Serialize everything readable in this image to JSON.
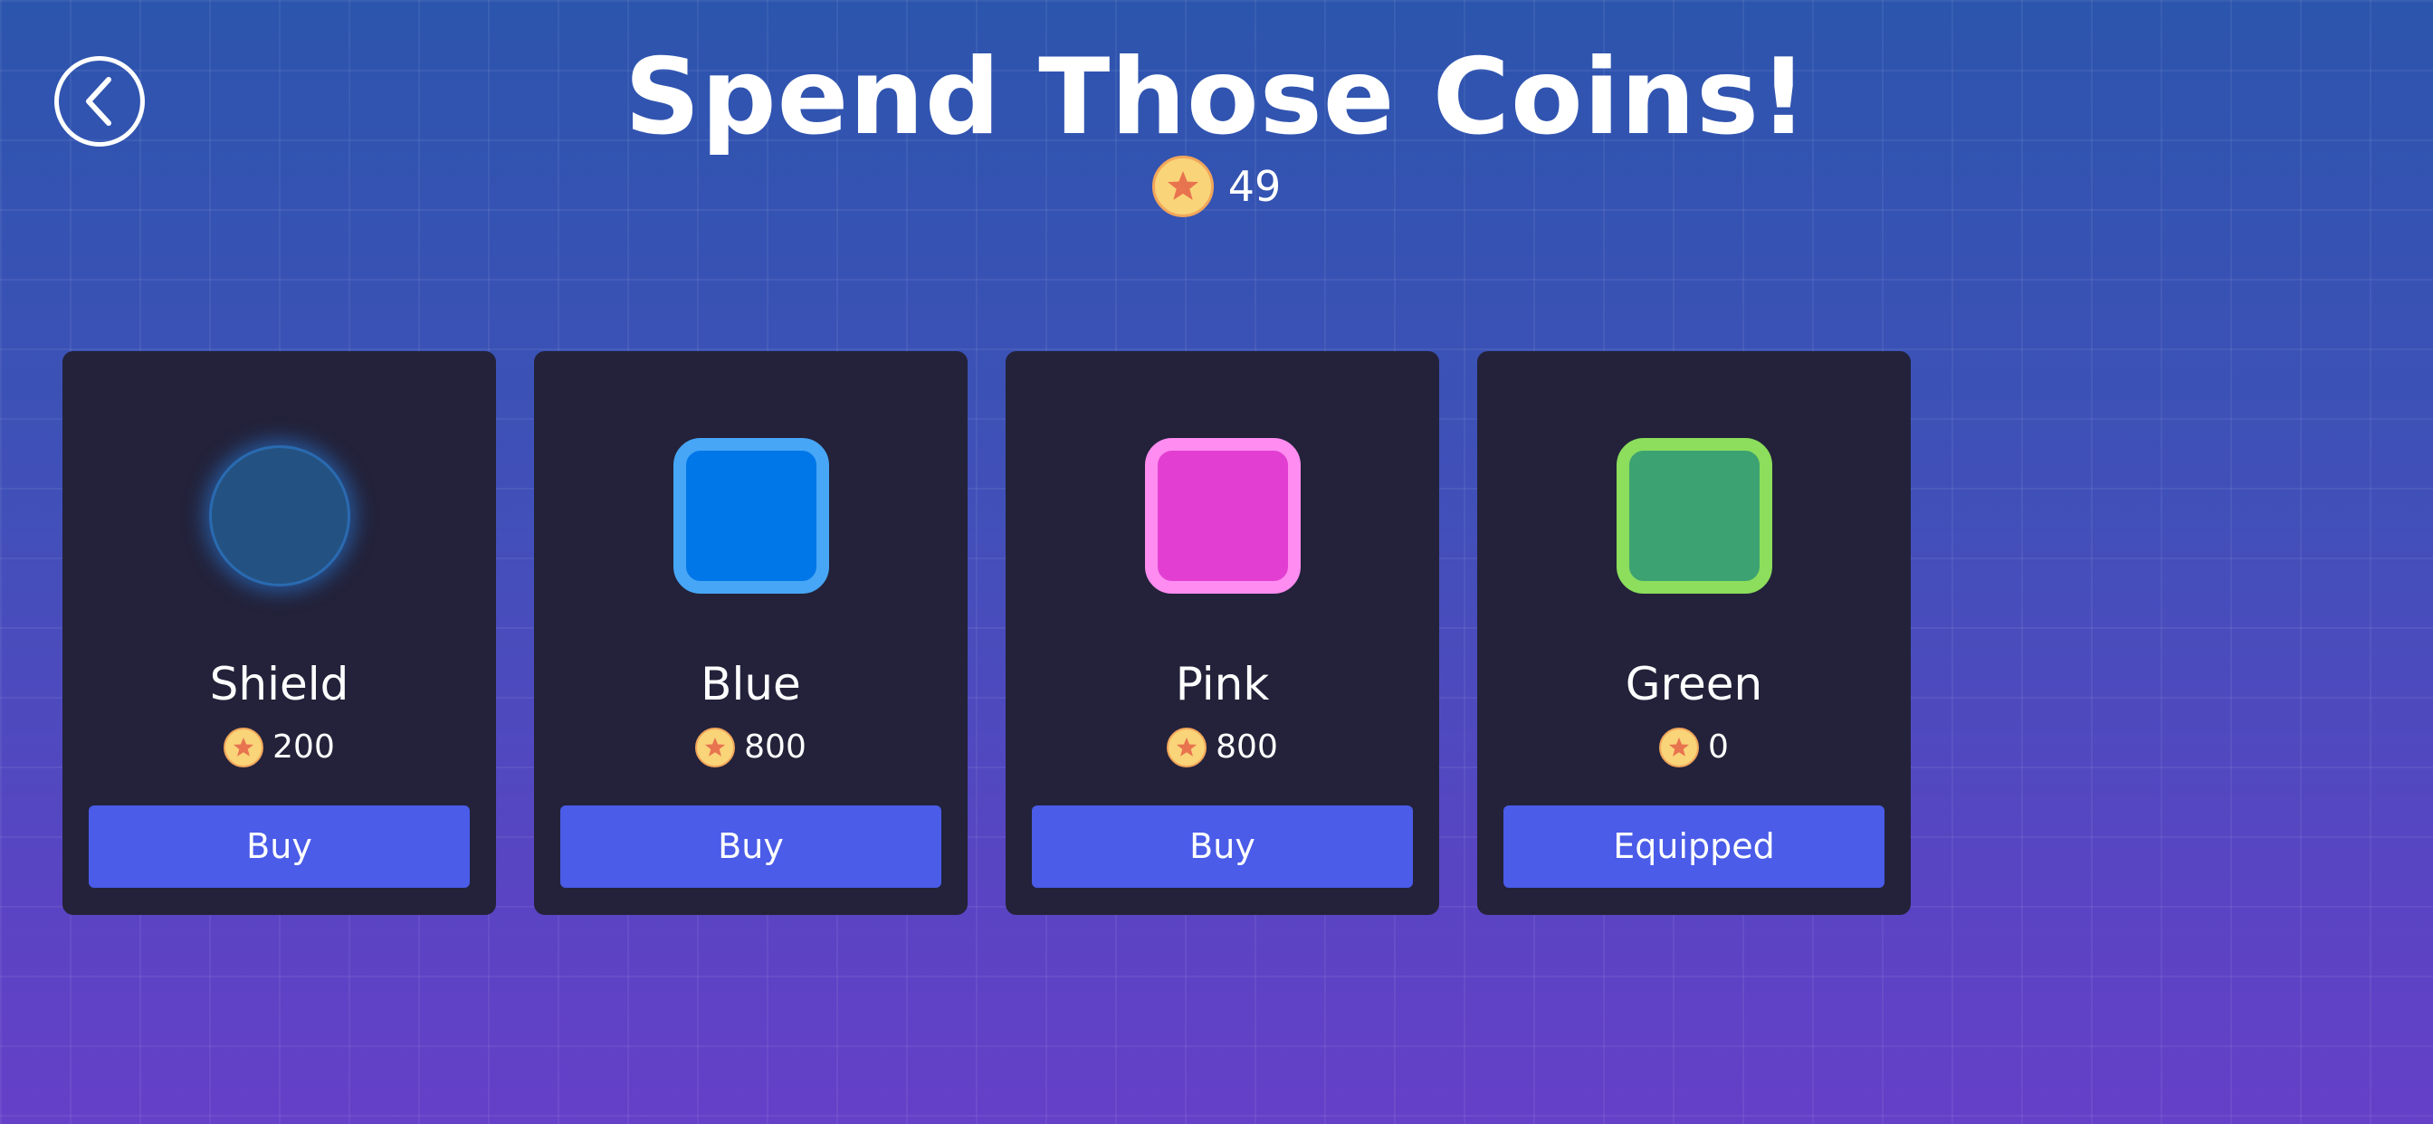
{
  "header": {
    "title": "Spend Those Coins!",
    "back_icon": "chevron-left-icon"
  },
  "balance": {
    "icon": "star-coin-icon",
    "value": "49"
  },
  "colors": {
    "card_bg": "#23223a",
    "button": "#4a5ce8",
    "coin_fill": "#f9d479",
    "coin_star": "#e8734f"
  },
  "shop": {
    "items": [
      {
        "name": "Shield",
        "price": "200",
        "action": "Buy",
        "preview": "shield-orb",
        "fill": "#235282",
        "border": "#2a6ab0"
      },
      {
        "name": "Blue",
        "price": "800",
        "action": "Buy",
        "preview": "square-skin",
        "fill": "#0077e8",
        "border": "#47a6f6"
      },
      {
        "name": "Pink",
        "price": "800",
        "action": "Buy",
        "preview": "square-skin",
        "fill": "#e23fd2",
        "border": "#ff8cf0"
      },
      {
        "name": "Green",
        "price": "0",
        "action": "Equipped",
        "preview": "square-skin",
        "fill": "#3da272",
        "border": "#8cde5c"
      }
    ]
  }
}
